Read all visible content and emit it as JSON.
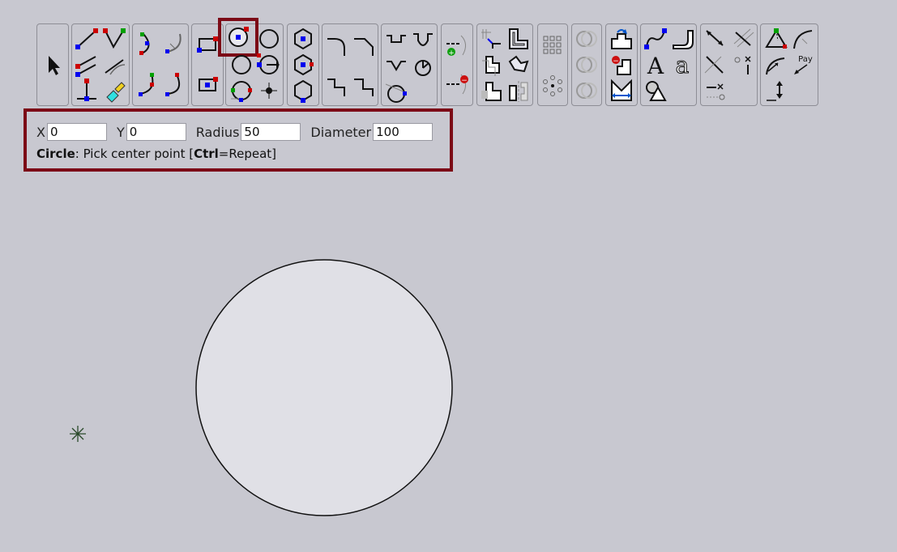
{
  "toolbar": {
    "active_tool": "circle-center-radius",
    "groups": [
      {
        "name": "select",
        "tools": [
          "select-arrow-icon"
        ]
      },
      {
        "name": "lines",
        "tools": [
          "line-icon",
          "line-angle-icon",
          "parallel-line-icon",
          "tangent-line-icon",
          "perpendicular-line-icon",
          "trim-marker-icon"
        ]
      },
      {
        "name": "arcs",
        "tools": [
          "arc-3pt-icon",
          "arc-center-icon",
          "arc-start-end-icon",
          "arc-tangent-icon"
        ]
      },
      {
        "name": "rectangles",
        "tools": [
          "rectangle-corner-icon",
          "rectangle-center-icon"
        ]
      },
      {
        "name": "circles",
        "tools": [
          "circle-center-radius-icon",
          "circle-2pt-icon",
          "circle-3pt-icon",
          "circle-tangent-icon",
          "circle-tan-tan-icon",
          "point-icon"
        ]
      },
      {
        "name": "polygons",
        "tools": [
          "hexagon-vertex-icon",
          "hexagon-center-icon",
          "hexagon-inscribed-icon"
        ]
      },
      {
        "name": "fillets",
        "tools": [
          "fillet-icon",
          "fillet-angled-icon",
          "chamfer-icon",
          "chamfer-step-icon"
        ]
      },
      {
        "name": "slots",
        "tools": [
          "slot-icon",
          "slot-round-icon",
          "v-notch-icon",
          "keyhole-icon",
          "circle-cut-icon"
        ]
      },
      {
        "name": "break",
        "tools": [
          "add-node-icon",
          "remove-node-icon"
        ]
      },
      {
        "name": "offset",
        "tools": [
          "trim-icon",
          "offset-icon",
          "offset-outline-icon",
          "offset-rotate-icon",
          "offset-copy-icon",
          "mirror-icon"
        ]
      },
      {
        "name": "arrays",
        "tools": [
          "grid-array-icon",
          "circular-array-icon"
        ]
      },
      {
        "name": "boolean",
        "tools": [
          "union-icon",
          "intersect-icon",
          "subtract-icon"
        ]
      },
      {
        "name": "profile",
        "tools": [
          "profile-add-icon",
          "profile-remove-icon",
          "profile-dimension-icon"
        ]
      },
      {
        "name": "text",
        "tools": [
          "spline-icon",
          "pipe-icon",
          "text-icon",
          "text-outline-icon",
          "shape-library-icon"
        ]
      },
      {
        "name": "dimensions",
        "tools": [
          "dimension-linear-icon",
          "dimension-aligned-icon",
          "dimension-angle-icon",
          "dimension-node-icon",
          "dimension-center-icon",
          "dimension-cross-icon"
        ]
      },
      {
        "name": "measure",
        "tools": [
          "measure-triangle-icon",
          "measure-arc-icon",
          "measure-angle-icon",
          "pay-label-icon",
          "measure-height-icon"
        ]
      }
    ],
    "pay_label": "Pay",
    "text_label": "A"
  },
  "panel": {
    "x_label": "X",
    "x_value": "0",
    "y_label": "Y",
    "y_value": "0",
    "radius_label": "Radius",
    "radius_value": "50",
    "diameter_label": "Diameter",
    "diameter_value": "100",
    "hint_tool": "Circle",
    "hint_text": ": Pick center point [",
    "hint_key": "Ctrl",
    "hint_suffix": "=Repeat]"
  },
  "colors": {
    "background": "#c8c8d0",
    "highlight": "#7c0a16",
    "circle_fill": "#e0e0e6",
    "node_blue": "#0000ee",
    "node_red": "#cc0000",
    "node_green": "#00a000",
    "origin_marker": "#2a4a2a"
  }
}
